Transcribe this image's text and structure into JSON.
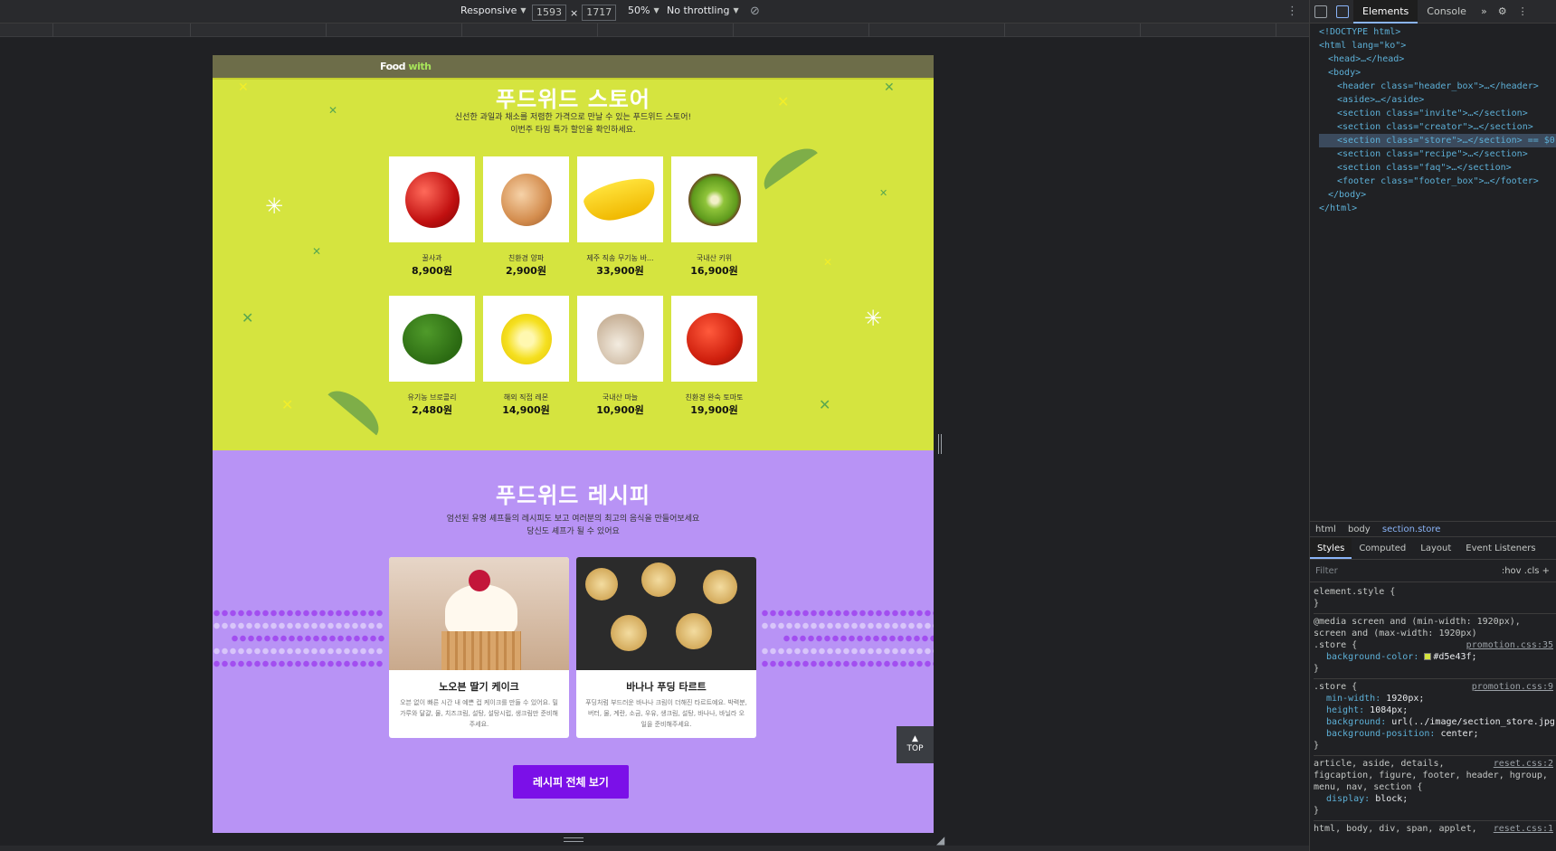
{
  "device_toolbar": {
    "dimensions_mode": "Responsive",
    "width": "1593",
    "times": "×",
    "height": "1717",
    "zoom": "50%",
    "throttling": "No throttling"
  },
  "site": {
    "logo_food": "Food",
    "logo_with": "with",
    "store": {
      "title": "푸드위드 스토어",
      "subtitle_line1": "신선한 과일과 채소를 저렴한 가격으로 만날 수 있는 푸드위드 스토어!",
      "subtitle_line2": "이번주 타임 특가 할인을 확인하세요.",
      "products": [
        {
          "name": "꿀사과",
          "price": "8,900원"
        },
        {
          "name": "친환경 양파",
          "price": "2,900원"
        },
        {
          "name": "제주 직송 무기농 바...",
          "price": "33,900원"
        },
        {
          "name": "국내산 키위",
          "price": "16,900원"
        },
        {
          "name": "유기농 브로콜리",
          "price": "2,480원"
        },
        {
          "name": "해외 직접 레몬",
          "price": "14,900원"
        },
        {
          "name": "국내산 마늘",
          "price": "10,900원"
        },
        {
          "name": "친환경 완숙 토마토",
          "price": "19,900원"
        }
      ]
    },
    "recipe": {
      "title": "푸드위드 레시피",
      "subtitle_line1": "엄선된 유명 셰프들의 레시피도 보고 여러분의 최고의 음식을 만들어보세요",
      "subtitle_line2": "당신도 셰프가 될 수 있어요",
      "cards": [
        {
          "title": "노오븐 딸기 케이크",
          "desc": "오븐 없이 빠른 시간 내 예쁜 컵 케이크를 만들 수 있어요. 밀가루와 달걀, 물, 치즈크림, 설탕, 설탕시럽, 생크림만 준비해주세요."
        },
        {
          "title": "바나나 푸딩 타르트",
          "desc": "푸딩처럼 부드러운 바나나 크림이 더해진 타르트예요. 박력분, 버터, 물, 계란, 소금, 우유, 생크림, 설탕, 바나나, 바닐라 오일을 준비해주세요."
        }
      ],
      "button": "레시피 전체 보기"
    },
    "top_button": "TOP"
  },
  "devtools": {
    "tabs": [
      "Elements",
      "Console"
    ],
    "dom": {
      "doctype": "<!DOCTYPE html>",
      "html_open": "<html lang=\"ko\">",
      "head": "<head>…</head>",
      "body_open": "<body>",
      "children": [
        "<header class=\"header_box\">…</header>",
        "<aside>…</aside>",
        "<section class=\"invite\">…</section>",
        "<section class=\"creator\">…</section>",
        "<section class=\"store\">…</section> == $0",
        "<section class=\"recipe\">…</section>",
        "<section class=\"faq\">…</section>",
        "<footer class=\"footer_box\">…</footer>"
      ],
      "body_close": "</body>",
      "html_close": "</html>"
    },
    "breadcrumbs": [
      "html",
      "body",
      "section.store"
    ],
    "panel_tabs": [
      "Styles",
      "Computed",
      "Layout",
      "Event Listeners"
    ],
    "filter_placeholder": "Filter",
    "filter_buttons": ":hov  .cls  +",
    "styles": {
      "element_style": "element.style {",
      "close": "}",
      "media": "@media screen and (min-width: 1920px), screen and (max-width: 1920px)",
      "store_sel": ".store {",
      "src1": "promotion.css:35",
      "bg_prop": "background-color",
      "bg_val": "#d5e43f;",
      "src2": "promotion.css:9",
      "minw_prop": "min-width",
      "minw_val": "1920px;",
      "height_prop": "height",
      "height_val": "1084px;",
      "background_prop": "background",
      "background_val": "url(../image/section_store.jpg) no-repeat 0 0;",
      "bgpos_prop": "background-position",
      "bgpos_val": "center;",
      "reset_sel": "article, aside, details, figcaption, figure, footer, header, hgroup, menu, nav, section {",
      "src3": "reset.css:2",
      "display_prop": "display",
      "display_val": "block;",
      "reset2_sel": "html, body, div, span, applet,",
      "src4": "reset.css:1"
    }
  },
  "colors": {
    "store_bg": "#d5e43f",
    "recipe_bg": "#b893f5",
    "button_bg": "#7b10e8"
  }
}
